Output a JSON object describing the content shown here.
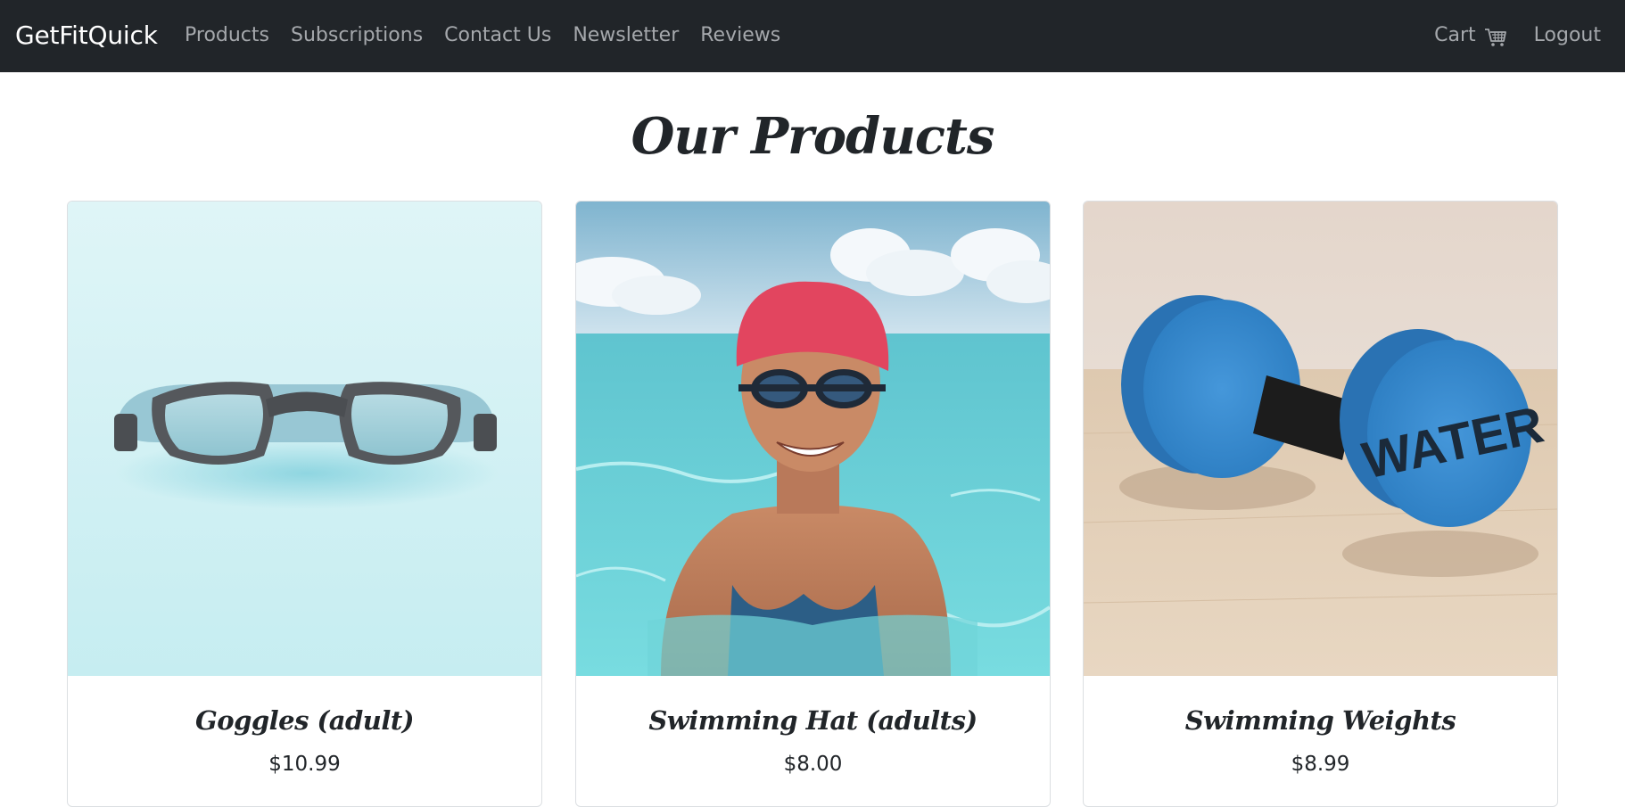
{
  "navbar": {
    "brand": "GetFitQuick",
    "links": [
      {
        "label": "Products"
      },
      {
        "label": "Subscriptions"
      },
      {
        "label": "Contact Us"
      },
      {
        "label": "Newsletter"
      },
      {
        "label": "Reviews"
      }
    ],
    "cart_label": "Cart",
    "cart_icon": "cart-icon",
    "logout_label": "Logout",
    "background_color": "#212529"
  },
  "main": {
    "title": "Our Products",
    "products": [
      {
        "name": "Goggles (adult)",
        "price": "$10.99",
        "image": "goggles-image"
      },
      {
        "name": "Swimming Hat (adults)",
        "price": "$8.00",
        "image": "swimmer-image"
      },
      {
        "name": "Swimming Weights",
        "price": "$8.99",
        "image": "water-dumbbell-image",
        "image_text": "WATER"
      }
    ]
  }
}
